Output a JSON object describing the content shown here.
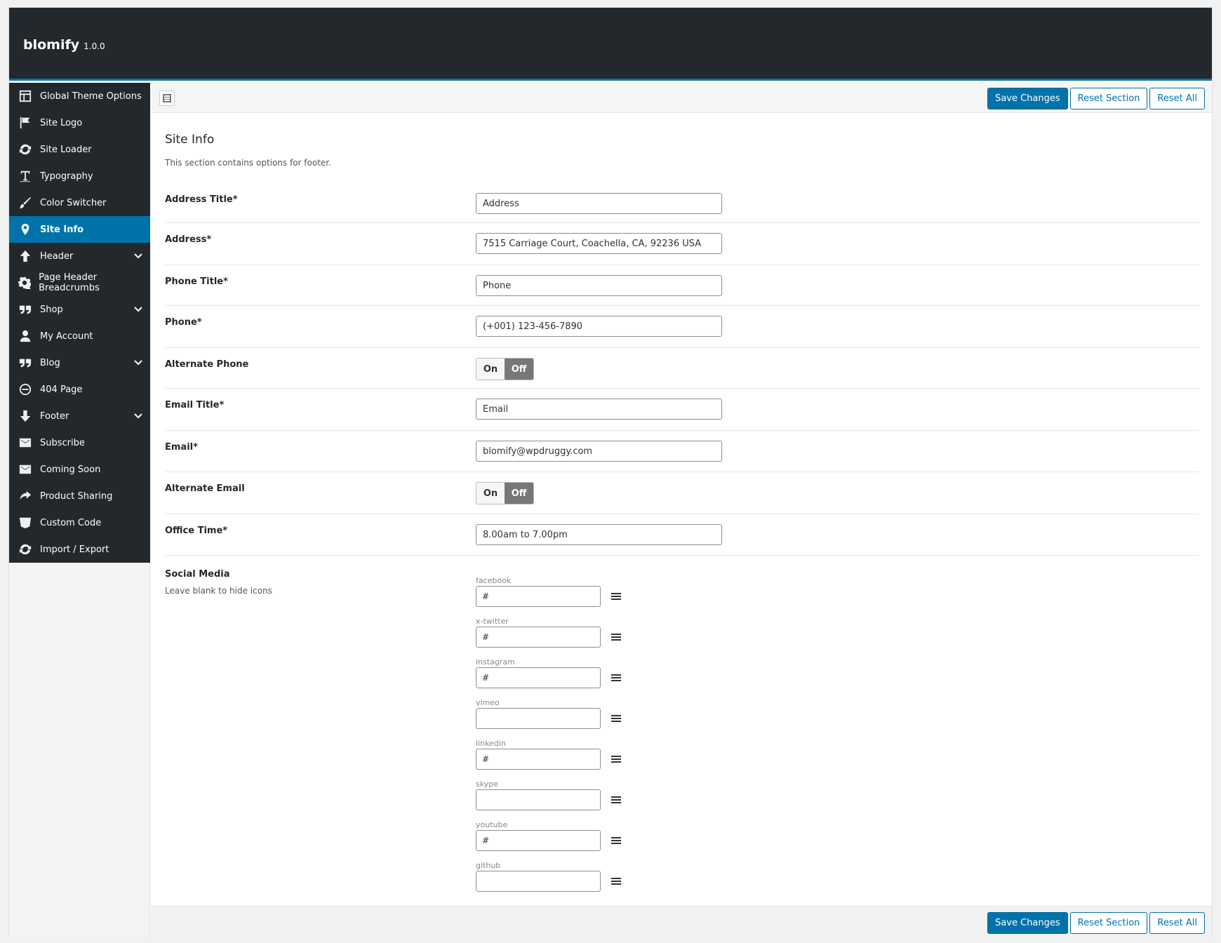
{
  "header": {
    "brand": "blomify",
    "version": "1.0.0"
  },
  "sidebar": {
    "items": [
      {
        "label": "Global Theme Options",
        "icon": "layout-icon"
      },
      {
        "label": "Site Logo",
        "icon": "flag-icon"
      },
      {
        "label": "Site Loader",
        "icon": "refresh-icon"
      },
      {
        "label": "Typography",
        "icon": "text-icon"
      },
      {
        "label": "Color Switcher",
        "icon": "brush-icon"
      },
      {
        "label": "Site Info",
        "icon": "location-pin-icon",
        "active": true
      },
      {
        "label": "Header",
        "icon": "arrow-up-icon",
        "expandable": true
      },
      {
        "label": "Page Header Breadcrumbs",
        "icon": "gear-icon"
      },
      {
        "label": "Shop",
        "icon": "quote-icon",
        "expandable": true
      },
      {
        "label": "My Account",
        "icon": "user-icon"
      },
      {
        "label": "Blog",
        "icon": "quote-icon",
        "expandable": true
      },
      {
        "label": "404 Page",
        "icon": "no-entry-icon"
      },
      {
        "label": "Footer",
        "icon": "arrow-down-icon",
        "expandable": true
      },
      {
        "label": "Subscribe",
        "icon": "envelope-icon"
      },
      {
        "label": "Coming Soon",
        "icon": "envelope-icon"
      },
      {
        "label": "Product Sharing",
        "icon": "share-icon"
      },
      {
        "label": "Custom Code",
        "icon": "css-icon"
      },
      {
        "label": "Import / Export",
        "icon": "refresh-icon"
      }
    ]
  },
  "toolbar": {
    "save_label": "Save Changes",
    "reset_section_label": "Reset Section",
    "reset_all_label": "Reset All"
  },
  "section": {
    "title": "Site Info",
    "description": "This section contains options for footer."
  },
  "fields": {
    "address_title": {
      "label": "Address Title*",
      "value": "Address"
    },
    "address": {
      "label": "Address*",
      "value": "7515 Carriage Court, Coachella, CA, 92236 USA"
    },
    "phone_title": {
      "label": "Phone Title*",
      "value": "Phone"
    },
    "phone": {
      "label": "Phone*",
      "value": "(+001) 123-456-7890"
    },
    "alternate_phone": {
      "label": "Alternate Phone",
      "on": "On",
      "off": "Off",
      "state": "off"
    },
    "email_title": {
      "label": "Email Title*",
      "value": "Email"
    },
    "email": {
      "label": "Email*",
      "value": "blomify@wpdruggy.com"
    },
    "alternate_email": {
      "label": "Alternate Email",
      "on": "On",
      "off": "Off",
      "state": "off"
    },
    "office_time": {
      "label": "Office Time*",
      "value": "8.00am to 7.00pm"
    }
  },
  "social": {
    "label": "Social Media",
    "hint": "Leave blank to hide icons",
    "items": [
      {
        "name": "facebook",
        "value": "#"
      },
      {
        "name": "x-twitter",
        "value": "#"
      },
      {
        "name": "instagram",
        "value": "#"
      },
      {
        "name": "vimeo",
        "value": ""
      },
      {
        "name": "linkedin",
        "value": "#"
      },
      {
        "name": "skype",
        "value": ""
      },
      {
        "name": "youtube",
        "value": "#"
      },
      {
        "name": "github",
        "value": ""
      }
    ]
  },
  "colors": {
    "sidebar_bg": "#23282d",
    "accent": "#0073aa"
  }
}
